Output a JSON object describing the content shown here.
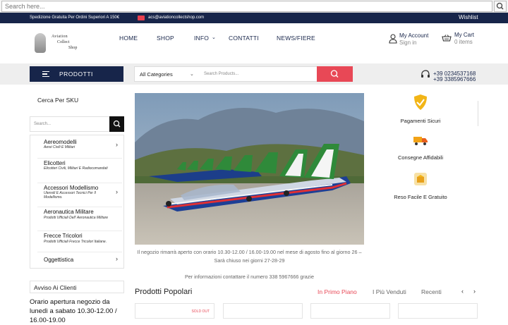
{
  "browser": {
    "search_placeholder": "Search here..."
  },
  "topbar": {
    "shipping": "Spedizione Gratuita Per Ordini Superiori A 150€",
    "email": "acs@aviationcollectshop.com",
    "wishlist": "Wishlist"
  },
  "logo": {
    "line1": "Aviation",
    "line2": "Collect",
    "line3": "Shop"
  },
  "nav": {
    "home": "HOME",
    "shop": "SHOP",
    "info": "INFO",
    "contatti": "CONTATTI",
    "news": "NEWS/FIERE"
  },
  "account": {
    "title": "My Account",
    "sub": "Sign in"
  },
  "cart": {
    "title": "My Cart",
    "sub": "0 items"
  },
  "catbar": {
    "products_label": "PRODOTTI",
    "category_select": "All Categories",
    "search_placeholder": "Search Products...",
    "phone1": "+39 0234537168",
    "phone2": "+39 3385967666"
  },
  "sidebar": {
    "title": "Cerca Per SKU",
    "sku_placeholder": "Search...",
    "categories": [
      {
        "label": "Aereomodelli",
        "sub": "Aerei Civili E Militari",
        "arrow": "›"
      },
      {
        "label": "Elicotteri",
        "sub": "Elicotteri Civili, Militari E Radiocomandati",
        "arrow": ""
      },
      {
        "label": "Accessori Modellismo",
        "sub": "Utensili E Accessori Tecnici Per Il Modellismo.",
        "arrow": "›"
      },
      {
        "label": "Aeronautica Militare",
        "sub": "Prodotti Ufficiali Dell' Aeronautica Militare",
        "arrow": ""
      },
      {
        "label": "Frecce Tricolori",
        "sub": "Prodotti Ufficiali Frecce Tricolori Italiane.",
        "arrow": ""
      },
      {
        "label": "Oggettistica",
        "sub": "",
        "arrow": "›"
      }
    ],
    "notice_title": "Avviso Ai Clienti",
    "notice_text": "Orario apertura negozio da lunedì a sabato 10.30-12.00 / 16.00-19.00"
  },
  "main": {
    "caption1": "Il negozio rimarrà aperto con orario 10.30-12.00 / 16.00-19.00 nel mese di agosto fino al giorno 26 – Sarà chiuso nei giorni 27-28-29",
    "caption2": "Per informazioni contattare il numero 338 5967666 grazie",
    "popular_title": "Prodotti Popolari",
    "tabs": [
      "In Primo Piano",
      "I Più Venduti",
      "Recenti"
    ],
    "sold_out": "SOLD OUT",
    "accent_color": "#e84856"
  },
  "features": [
    {
      "label": "Pagamenti Sicuri",
      "icon": "shield-check-icon"
    },
    {
      "label": "Consegne Affidabili",
      "icon": "truck-icon"
    },
    {
      "label": "Reso Facile E Gratuito",
      "icon": "return-box-icon"
    }
  ],
  "colors": {
    "navy": "#17254a",
    "red": "#e84856"
  }
}
